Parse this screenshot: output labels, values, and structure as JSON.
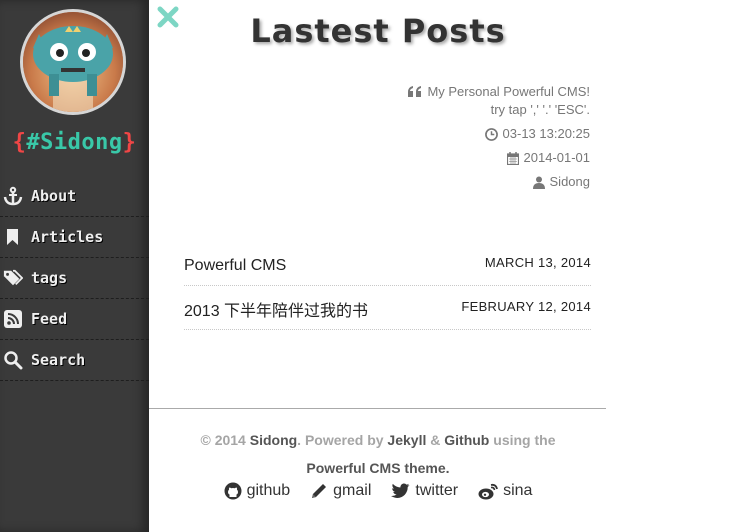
{
  "sidebar": {
    "brand": {
      "open": "{",
      "name": "#Sidong",
      "close": "}"
    },
    "items": [
      {
        "label": "About",
        "icon": "anchor-icon"
      },
      {
        "label": "Articles",
        "icon": "bookmark-icon"
      },
      {
        "label": "tags",
        "icon": "tags-icon"
      },
      {
        "label": "Feed",
        "icon": "rss-icon"
      },
      {
        "label": "Search",
        "icon": "search-icon"
      }
    ]
  },
  "main": {
    "title": "Lastest Posts",
    "meta": {
      "quote_line1": "My Personal Powerful CMS!",
      "quote_line2": "try tap ',' '.' 'ESC'.",
      "time": "03-13 13:20:25",
      "date": "2014-01-01",
      "author": "Sidong"
    },
    "posts": [
      {
        "title": "Powerful CMS",
        "date": "MARCH 13, 2014"
      },
      {
        "title": "2013 下半年陪伴过我的书",
        "date": "FEBRUARY 12, 2014"
      }
    ]
  },
  "footer": {
    "copyright": "© 2014",
    "owner": "Sidong",
    "powered": ". Powered by",
    "jekyll": "Jekyll",
    "amp": "&",
    "github": "Github",
    "using": "using the",
    "theme": "Powerful CMS theme."
  },
  "social": [
    {
      "label": "github",
      "icon": "github-icon"
    },
    {
      "label": "gmail",
      "icon": "pencil-icon"
    },
    {
      "label": "twitter",
      "icon": "twitter-icon"
    },
    {
      "label": "sina",
      "icon": "weibo-icon"
    }
  ],
  "colors": {
    "accent": "#39c8a8",
    "brace": "#f04646",
    "sidebar": "#3a3a3a",
    "close": "#7dd6c4"
  }
}
